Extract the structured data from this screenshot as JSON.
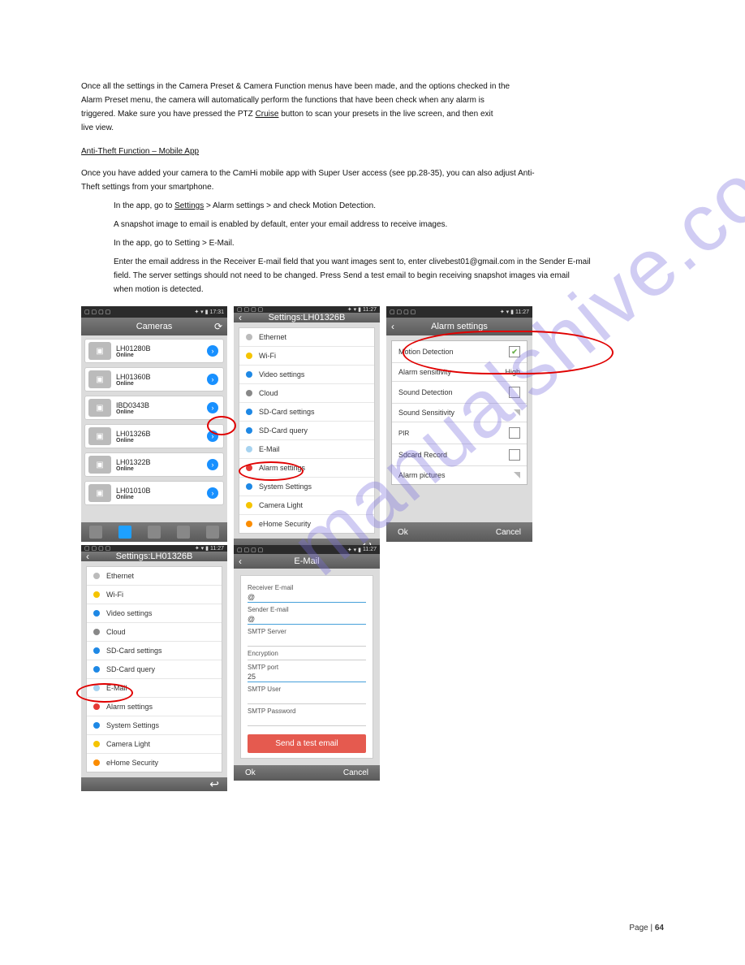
{
  "watermark": "manualshive.com",
  "intro": {
    "p1": "Once all the settings in the Camera Preset & Camera Function menus have been made, and the options checked in the",
    "p2": "Alarm Preset menu, the camera will automatically perform the functions that have been check when any alarm is",
    "p3": "triggered. Make sure you have pressed the PTZ",
    "p3b": "Cruise",
    "p3c": "button to scan your presets in the live screen, and then exit",
    "p4": "live view.",
    "heading": "Anti-Theft Function – Mobile App",
    "a1": "Once you have added your camera to the CamHi mobile app with Super User access (see pp.28-35), you can also adjust Anti-",
    "a2": "Theft settings from your smartphone.",
    "a3": "In the app, go to",
    "a3b": "Settings",
    "a3c": "> Alarm settings > and check Motion Detection.",
    "a4": "A snapshot image to email is enabled by default, enter your email address to receive images.",
    "a5": "In the app, go to Setting > E-Mail.",
    "a6": "Enter the email address in the Receiver E-mail field that you want images sent to, enter clivebest01@gmail.com in the Sender E-mail",
    "a7": "field. The server settings should not need to be changed. Press Send a test email to begin receiving snapshot images via email",
    "a8": "when motion is detected."
  },
  "s1": {
    "time": "17:31",
    "title": "Cameras",
    "cams": [
      {
        "name": "LH01280B",
        "sub": "Online"
      },
      {
        "name": "LH01360B",
        "sub": "Online"
      },
      {
        "name": "IBD0343B",
        "sub": "Online"
      },
      {
        "name": "LH01326B",
        "sub": "Online"
      },
      {
        "name": "LH01322B",
        "sub": "Online"
      },
      {
        "name": "LH01010B",
        "sub": "Online"
      }
    ]
  },
  "s2": {
    "time": "11:27",
    "title": "Settings:LH01326B",
    "items": [
      "Ethernet",
      "Wi-Fi",
      "Video settings",
      "Cloud",
      "SD-Card settings",
      "SD-Card query",
      "E-Mail",
      "Alarm settings",
      "System Settings",
      "Camera Light",
      "eHome Security"
    ]
  },
  "s3": {
    "time": "11:27",
    "title": "Alarm settings",
    "rows": [
      {
        "label": "Motion Detection",
        "ctl": "check_on"
      },
      {
        "label": "Alarm sensitivity",
        "ctl": "high"
      },
      {
        "label": "Sound Detection",
        "ctl": "check"
      },
      {
        "label": "Sound Sensitivity",
        "ctl": "tri"
      },
      {
        "label": "PIR",
        "ctl": "check"
      },
      {
        "label": "Sdcard Record",
        "ctl": "check"
      },
      {
        "label": "Alarm pictures",
        "ctl": "tri"
      }
    ],
    "high": "High",
    "ok": "Ok",
    "cancel": "Cancel"
  },
  "s4": {
    "time": "11:27",
    "title": "Settings:LH01326B",
    "items": [
      "Ethernet",
      "Wi-Fi",
      "Video settings",
      "Cloud",
      "SD-Card settings",
      "SD-Card query",
      "E-Mail",
      "Alarm settings",
      "System Settings",
      "Camera Light",
      "eHome Security"
    ]
  },
  "s5": {
    "time": "11:27",
    "title": "E-Mail",
    "fields": {
      "recv_l": "Receiver E-mail",
      "recv_v": "@",
      "send_l": "Sender E-mail",
      "send_v": "@",
      "srv_l": "SMTP Server",
      "srv_v": "",
      "enc_l": "Encryption",
      "enc_v": "",
      "port_l": "SMTP port",
      "port_v": "25",
      "user_l": "SMTP User",
      "user_v": "",
      "pass_l": "SMTP Password",
      "pass_v": ""
    },
    "test": "Send a test email",
    "ok": "Ok",
    "cancel": "Cancel"
  },
  "footer": {
    "label": "Page |",
    "num": "64"
  }
}
